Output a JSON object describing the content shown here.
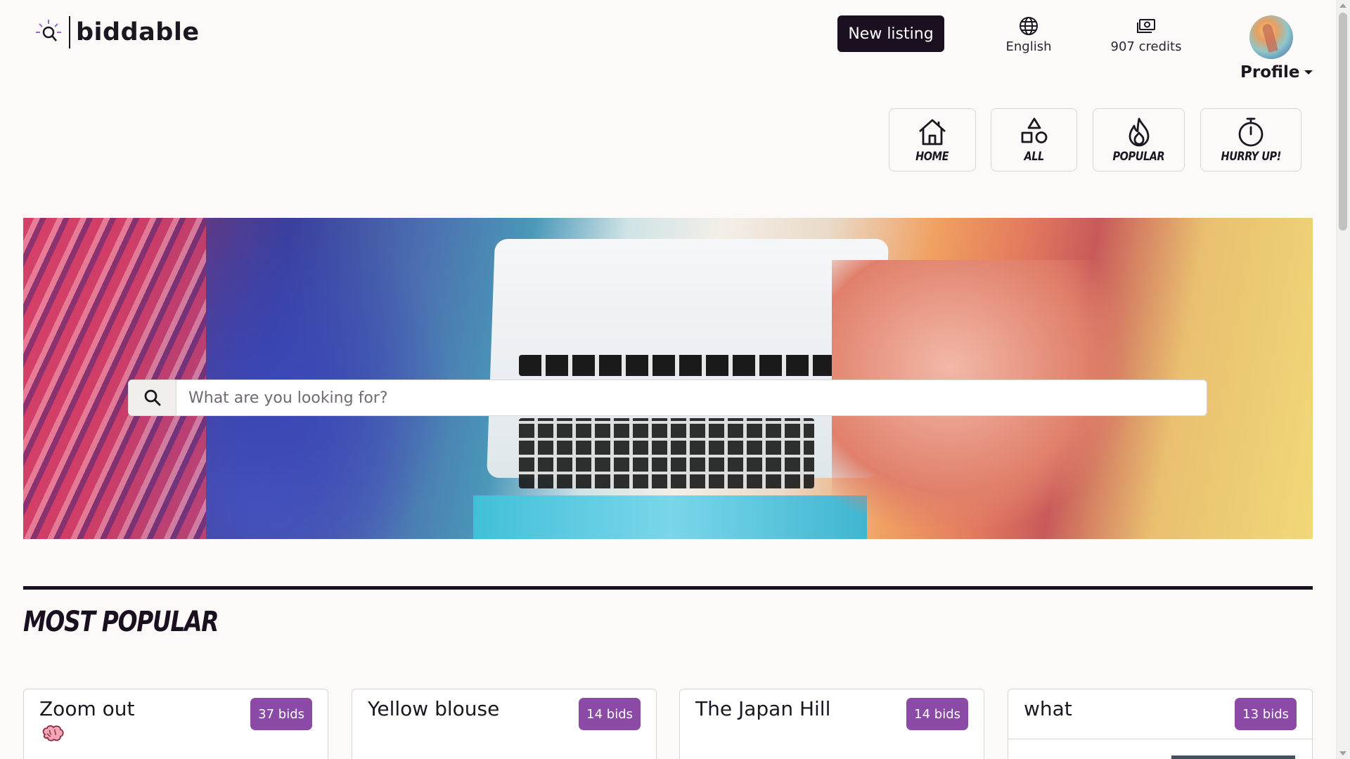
{
  "brand": {
    "name": "biddable",
    "icon": "lightbulb-logo-icon"
  },
  "header": {
    "new_listing_label": "New listing",
    "language_label": "English",
    "language_icon": "globe-icon",
    "credits_label": "907 credits",
    "credits_icon": "money-icon",
    "profile_label": "Profile"
  },
  "nav": [
    {
      "label": "Home",
      "icon": "home-icon"
    },
    {
      "label": "All",
      "icon": "shapes-icon"
    },
    {
      "label": "Popular",
      "icon": "flame-icon"
    },
    {
      "label": "Hurry up!",
      "icon": "stopwatch-icon"
    }
  ],
  "search": {
    "placeholder": "What are you looking for?",
    "icon": "search-icon"
  },
  "section": {
    "title": "Most popular"
  },
  "listings": [
    {
      "title": "Zoom out",
      "emoji": "brain-icon",
      "bids": "37 bids"
    },
    {
      "title": "Yellow blouse",
      "bids": "14 bids"
    },
    {
      "title": "The Japan Hill",
      "bids": "14 bids"
    },
    {
      "title": "what",
      "bids": "13 bids"
    }
  ],
  "colors": {
    "accent": "#8b4aa6",
    "dark": "#1a1020",
    "background": "#fbfaf8"
  }
}
